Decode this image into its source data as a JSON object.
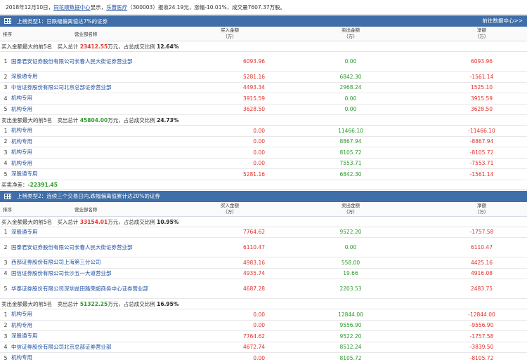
{
  "topline": {
    "pre": "2018年12月10日，",
    "src": "同花顺数据中心",
    "mid": "显示，",
    "stock": "乐普医疗",
    "post": "（300003）报收24.19元，涨幅-10.01%，成交量7607.37万股。"
  },
  "columns": {
    "rank": "排序",
    "name": "营业部名称",
    "buy": "买入金额",
    "sell": "卖出金额",
    "net": "净额",
    "unit": "（万）"
  },
  "sections": [
    {
      "title": "上榜类型1：日跌幅偏离值达7%的证券",
      "more": "前往数据中心>>",
      "buy_label": "买入金额最大的前5名",
      "buy_total_pre": "买入总计",
      "buy_total": "23412.55",
      "buy_total_unit": "万元，占总成交比例",
      "buy_pct": "12.64%",
      "buy_rows": [
        {
          "rank": "1",
          "name": "国泰君安证券股份有限公司长春人民大街证券营业部",
          "buy": "6093.96",
          "sell": "0.00",
          "net": "6093.96"
        },
        {
          "rank": "2",
          "name": "深股通专用",
          "buy": "5281.16",
          "sell": "6842.30",
          "net": "-1561.14"
        },
        {
          "rank": "3",
          "name": "中信证券股份有限公司北京总部证券营业部",
          "buy": "4493.34",
          "sell": "2968.24",
          "net": "1525.10"
        },
        {
          "rank": "4",
          "name": "机构专用",
          "buy": "3915.59",
          "sell": "0.00",
          "net": "3915.59"
        },
        {
          "rank": "5",
          "name": "机构专用",
          "buy": "3628.50",
          "sell": "0.00",
          "net": "3628.50"
        }
      ],
      "sell_label": "卖出金额最大的前5名",
      "sell_total_pre": "卖出总计",
      "sell_total": "45804.00",
      "sell_total_unit": "万元，占总成交比例",
      "sell_pct": "24.73%",
      "sell_rows": [
        {
          "rank": "1",
          "name": "机构专用",
          "buy": "0.00",
          "sell": "11466.10",
          "net": "-11466.10"
        },
        {
          "rank": "2",
          "name": "机构专用",
          "buy": "0.00",
          "sell": "8867.94",
          "net": "-8867.94"
        },
        {
          "rank": "3",
          "name": "机构专用",
          "buy": "0.00",
          "sell": "8105.72",
          "net": "-8105.72"
        },
        {
          "rank": "4",
          "name": "机构专用",
          "buy": "0.00",
          "sell": "7553.71",
          "net": "-7553.71"
        },
        {
          "rank": "5",
          "name": "深股通专用",
          "buy": "5281.16",
          "sell": "6842.30",
          "net": "-1561.14"
        }
      ],
      "net_label": "买卖净差：",
      "net_value": "-22391.45"
    },
    {
      "title": "上榜类型2：连续三个交易日内,跌幅偏离值累计达20%的证券",
      "more": "",
      "buy_label": "买入金额最大的前5名",
      "buy_total_pre": "买入总计",
      "buy_total": "33154.01",
      "buy_total_unit": "万元，占总成交比例",
      "buy_pct": "10.95%",
      "buy_rows": [
        {
          "rank": "1",
          "name": "深股通专用",
          "buy": "7764.62",
          "sell": "9522.20",
          "net": "-1757.58"
        },
        {
          "rank": "2",
          "name": "国泰君安证券股份有限公司长春人民大街证券营业部",
          "buy": "6110.47",
          "sell": "0.00",
          "net": "6110.47"
        },
        {
          "rank": "3",
          "name": "西部证券股份有限公司上海第三分公司",
          "buy": "4983.16",
          "sell": "558.00",
          "net": "4425.16"
        },
        {
          "rank": "4",
          "name": "国信证券股份有限公司长沙五一大道营业部",
          "buy": "4935.74",
          "sell": "19.66",
          "net": "4916.08"
        },
        {
          "rank": "5",
          "name": "华泰证券股份有限公司深圳益田路荣超商务中心证券营业部",
          "buy": "4687.28",
          "sell": "2203.53",
          "net": "2483.75"
        }
      ],
      "sell_label": "卖出金额最大的前5名",
      "sell_total_pre": "卖出总计",
      "sell_total": "51322.25",
      "sell_total_unit": "万元，占总成交比例",
      "sell_pct": "16.95%",
      "sell_rows": [
        {
          "rank": "1",
          "name": "机构专用",
          "buy": "0.00",
          "sell": "12844.00",
          "net": "-12844.00"
        },
        {
          "rank": "2",
          "name": "机构专用",
          "buy": "0.00",
          "sell": "9556.90",
          "net": "-9556.90"
        },
        {
          "rank": "3",
          "name": "深股通专用",
          "buy": "7764.62",
          "sell": "9522.20",
          "net": "-1757.58"
        },
        {
          "rank": "4",
          "name": "中信证券股份有限公司北京总部证券营业部",
          "buy": "4672.74",
          "sell": "8512.24",
          "net": "-3839.50"
        },
        {
          "rank": "5",
          "name": "机构专用",
          "buy": "0.00",
          "sell": "8105.72",
          "net": "-8105.72"
        }
      ],
      "net_label": "买卖净差：",
      "net_value": "-18168.25"
    }
  ]
}
